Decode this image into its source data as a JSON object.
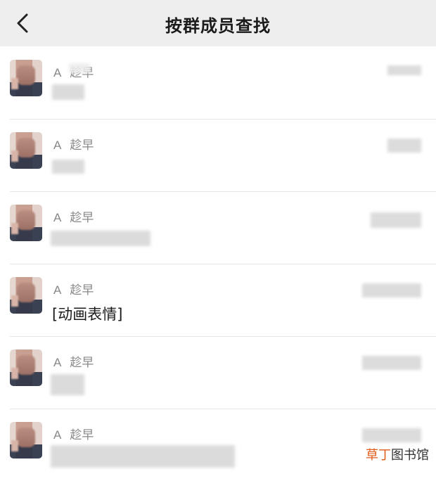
{
  "header": {
    "back_icon": "chevron-left-icon",
    "title": "按群成员查找"
  },
  "rows": [
    {
      "tag": "A",
      "name": "趁早",
      "message": ""
    },
    {
      "tag": "A",
      "name": "趁早",
      "message": ""
    },
    {
      "tag": "A",
      "name": "趁早",
      "message": ""
    },
    {
      "tag": "A",
      "name": "趁早",
      "message": "[动画表情]"
    },
    {
      "tag": "A",
      "name": "趁早",
      "message": ""
    },
    {
      "tag": "A",
      "name": "趁早",
      "message": ""
    }
  ],
  "watermark": {
    "accent": "草丁",
    "rest": "图书馆"
  }
}
